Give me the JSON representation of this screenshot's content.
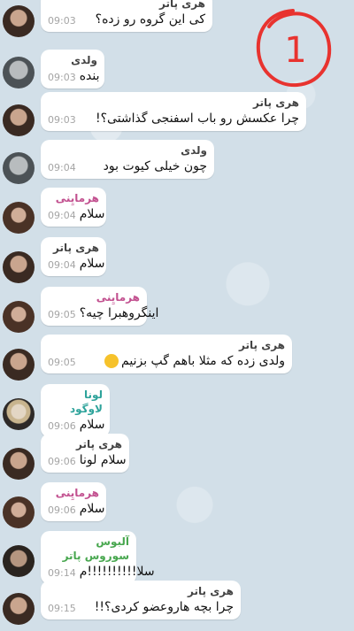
{
  "messages": [
    {
      "sender": "هری پاتر",
      "text": "کی این گروه رو زده؟",
      "time": "09:03",
      "avatar": "harry"
    },
    {
      "sender": "ولدی",
      "text": "بنده",
      "time": "09:03",
      "avatar": "voldy"
    },
    {
      "sender": "هری پاتر",
      "text": "چرا عکسش رو باب اسفنجی گذاشتی؟!",
      "time": "09:03",
      "avatar": "harry"
    },
    {
      "sender": "ولدی",
      "text": "چون خیلی کیوت بود",
      "time": "09:04",
      "avatar": "voldy"
    },
    {
      "sender": "هرمایِنی",
      "text": "سلام",
      "time": "09:04",
      "avatar": "hermione"
    },
    {
      "sender": "هری پاتر",
      "text": "سلام",
      "time": "09:04",
      "avatar": "harry"
    },
    {
      "sender": "هرمایِنی",
      "text": "اینگروهبرا چیه؟",
      "time": "09:05",
      "avatar": "hermione"
    },
    {
      "sender": "هری پاتر",
      "text": "ولدی زده که مثلا باهم گپ بزنیم",
      "time": "09:05",
      "avatar": "harry"
    },
    {
      "sender": "لونا لاوگود",
      "text": "سلام",
      "time": "09:06",
      "avatar": "luna"
    },
    {
      "sender": "هری پاتر",
      "text": "سلام لونا",
      "time": "09:06",
      "avatar": "harry"
    },
    {
      "sender": "هرمایِنی",
      "text": "سلام",
      "time": "09:06",
      "avatar": "hermione"
    },
    {
      "sender": "آلبوس سوروس پاتر",
      "text": "سلا!!!!!!!!!!م",
      "time": "09:14",
      "avatar": "albus"
    },
    {
      "sender": "هری پاتر",
      "text": "چرا بچه هاروعضو کردی؟!!",
      "time": "09:15",
      "avatar": "harry"
    }
  ],
  "stamp": "1",
  "colors": {
    "background": "#d2dfe8",
    "bubble": "#ffffff",
    "stamp": "#e8332f",
    "hermione": "#c2508f",
    "luna": "#2ea39b",
    "albus": "#48a74f"
  }
}
